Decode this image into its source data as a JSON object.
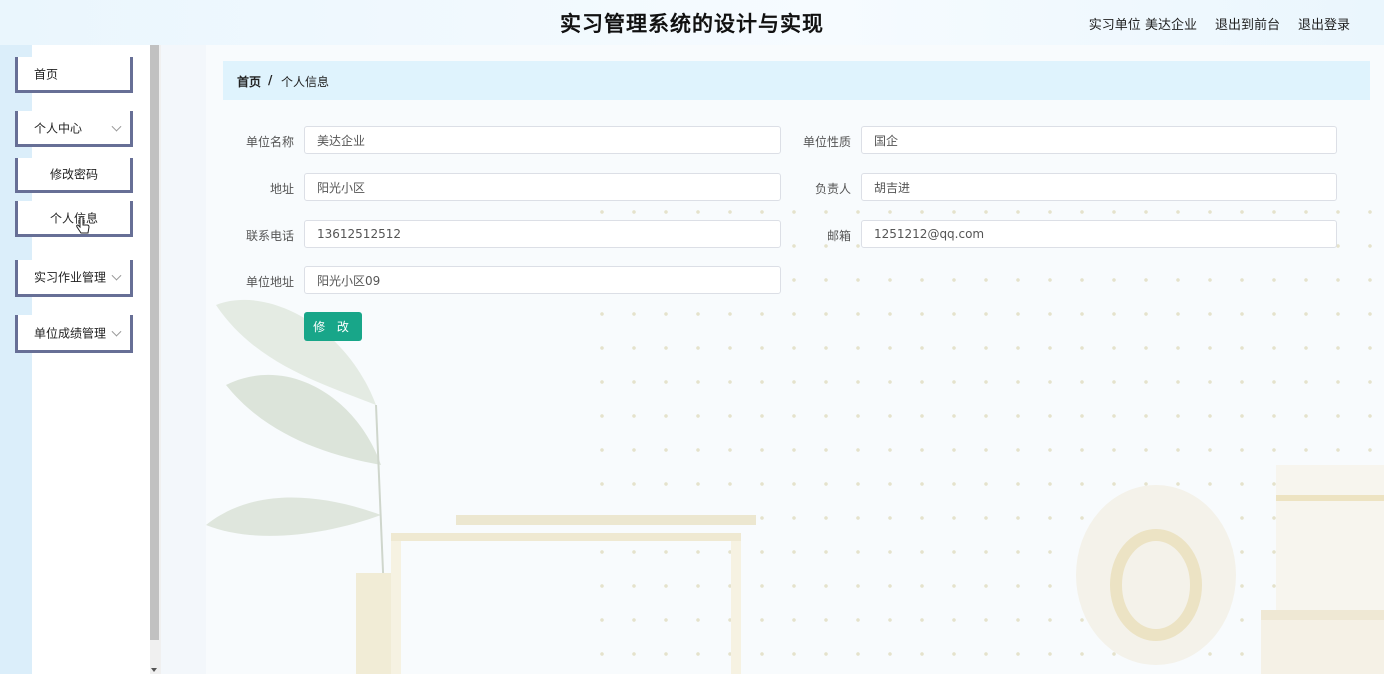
{
  "header": {
    "title": "实习管理系统的设计与实现",
    "user_role": "实习单位",
    "user_name": "美达企业",
    "back_to_front": "退出到前台",
    "logout": "退出登录"
  },
  "sidebar": {
    "items": [
      {
        "label": "首页"
      },
      {
        "label": "个人中心",
        "expanded": true
      },
      {
        "label": "修改密码"
      },
      {
        "label": "个人信息",
        "active": true
      },
      {
        "label": "实习作业管理"
      },
      {
        "label": "单位成绩管理"
      }
    ]
  },
  "breadcrumb": {
    "home": "首页",
    "separator": "/",
    "current": "个人信息"
  },
  "form": {
    "unit_name": {
      "label": "单位名称",
      "value": "美达企业"
    },
    "unit_nature": {
      "label": "单位性质",
      "value": "国企"
    },
    "address": {
      "label": "地址",
      "value": "阳光小区"
    },
    "principal": {
      "label": "负责人",
      "value": "胡吉进"
    },
    "phone": {
      "label": "联系电话",
      "value": "13612512512"
    },
    "email": {
      "label": "邮箱",
      "value": "1251212@qq.com"
    },
    "unit_address": {
      "label": "单位地址",
      "value": "阳光小区09"
    },
    "submit_label": "修 改"
  },
  "colors": {
    "primary_button": "#18a689",
    "breadcrumb_bg": "#dff3fd",
    "menu_border": "#676f96"
  }
}
